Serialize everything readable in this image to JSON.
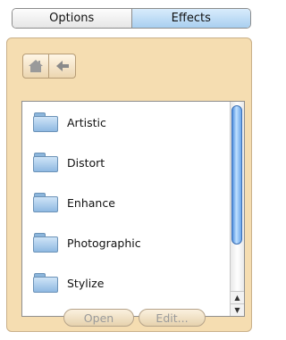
{
  "tabs": {
    "options": "Options",
    "effects": "Effects"
  },
  "nav": {
    "home_icon": "house-icon",
    "back_icon": "left-arrow-icon"
  },
  "list": {
    "items": [
      {
        "label": "Artistic",
        "icon": "folder-icon"
      },
      {
        "label": "Distort",
        "icon": "folder-icon"
      },
      {
        "label": "Enhance",
        "icon": "folder-icon"
      },
      {
        "label": "Photographic",
        "icon": "folder-icon"
      },
      {
        "label": "Stylize",
        "icon": "folder-icon"
      }
    ]
  },
  "buttons": {
    "open": "Open",
    "edit": "Edit..."
  },
  "colors": {
    "panel": "#f5ddb1",
    "active_tab": "#a9cff0",
    "scroll_thumb": "#4f8fe0"
  }
}
